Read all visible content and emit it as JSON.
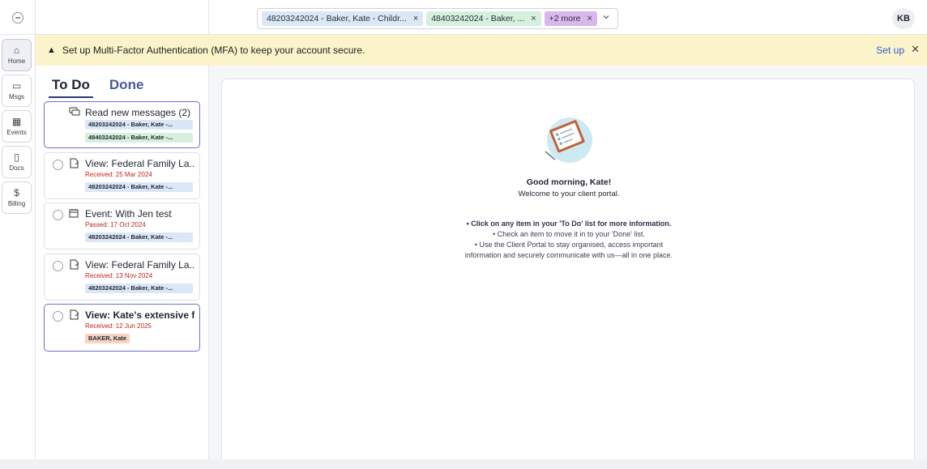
{
  "topbar": {
    "chips": [
      {
        "label": "48203242024 - Baker, Kate - Childr...",
        "remove": "×"
      },
      {
        "label": "48403242024 - Baker, ...",
        "remove": "×"
      },
      {
        "label": "+2 more",
        "remove": "×"
      }
    ],
    "avatar_initials": "KB"
  },
  "nav": {
    "items": [
      {
        "label": "Home",
        "icon": "⌂"
      },
      {
        "label": "Msgs",
        "icon": "▭"
      },
      {
        "label": "Events",
        "icon": "▦"
      },
      {
        "label": "Docs",
        "icon": "▯"
      },
      {
        "label": "Billing",
        "icon": "$"
      }
    ]
  },
  "banner": {
    "icon": "▲",
    "text": "Set up Multi-Factor Authentication (MFA) to keep your account secure.",
    "action": "Set up",
    "close": "✕"
  },
  "tabs": {
    "todo": "To Do",
    "done": "Done"
  },
  "cards": [
    {
      "title": "Read new messages (2)",
      "tags": [
        "48203242024 - Baker, Kate -...",
        "48403242024 - Baker, Kate -..."
      ]
    },
    {
      "title": "View: Federal Family La...",
      "sub": "Received: 25 Mar 2024",
      "tag": "48203242024 - Baker, Kate -..."
    },
    {
      "title": "Event: With Jen test",
      "sub": "Passed: 17 Oct 2024",
      "tag": "48203242024 - Baker, Kate -..."
    },
    {
      "title": "View: Federal Family La...",
      "sub": "Received: 13 Nov 2024",
      "tag": "48203242024 - Baker, Kate -..."
    },
    {
      "title": "View: Kate's extensive f...",
      "sub": "Received: 12 Jun 2025",
      "tag": "BAKER, Kate"
    }
  ],
  "main": {
    "greeting": "Good morning, Kate!",
    "welcome": "Welcome to your client portal.",
    "tip1": "•  Click on any item in your 'To Do' list for more information.",
    "tip2": "•  Check an item to move it in to your 'Done' list.",
    "tip3": "•  Use the Client Portal to stay organised, access important",
    "tip3b": "information and securely communicate with us—all in one place."
  }
}
